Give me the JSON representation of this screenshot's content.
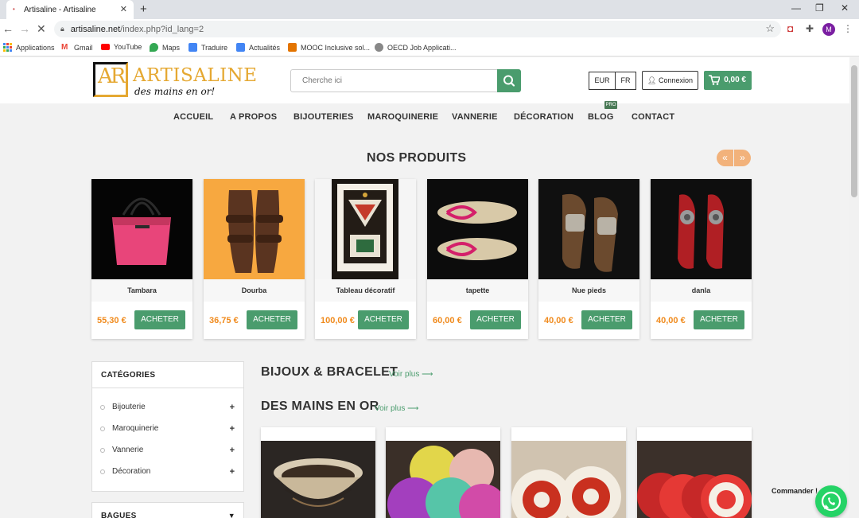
{
  "browser": {
    "tab_title": "Artisaline - Artisaline",
    "url_domain": "artisaline.net",
    "url_path": "/index.php?id_lang=2",
    "profile_initial": "M",
    "bookmarks": [
      {
        "label": "Applications",
        "color": "#4285f4"
      },
      {
        "label": "Gmail",
        "color": "#ea4335"
      },
      {
        "label": "YouTube",
        "color": "#ff0000"
      },
      {
        "label": "Maps",
        "color": "#34a853"
      },
      {
        "label": "Traduire",
        "color": "#4285f4"
      },
      {
        "label": "Actualités",
        "color": "#4285f4"
      },
      {
        "label": "MOOC Inclusive sol...",
        "color": "#e37400"
      },
      {
        "label": "OECD Job Applicati...",
        "color": "#666666"
      }
    ]
  },
  "header": {
    "logo_letters": "AR",
    "logo_name": "ARTISALINE",
    "logo_tagline": "des mains en or!",
    "search_placeholder": "Cherche ici",
    "currency_eur": "EUR",
    "lang_fr": "FR",
    "login_label": "Connexion",
    "cart_total": "0,00 €"
  },
  "nav": {
    "items": [
      "ACCUEIL",
      "A PROPOS",
      "BIJOUTERIES",
      "MAROQUINERIE",
      "VANNERIE",
      "DÉCORATION",
      "BLOG",
      "CONTACT"
    ],
    "blog_badge": "PRO"
  },
  "products_section": {
    "title": "NOS PRODUITS",
    "prev_icon": "«",
    "next_icon": "»",
    "buy_label": "ACHETER",
    "items": [
      {
        "name": "Tambara",
        "price": "55,30 €"
      },
      {
        "name": "Dourba",
        "price": "36,75 €"
      },
      {
        "name": "Tableau décoratif",
        "price": "100,00 €"
      },
      {
        "name": "tapette",
        "price": "60,00 €"
      },
      {
        "name": "Nue pieds",
        "price": "40,00 €"
      },
      {
        "name": "danla",
        "price": "40,00 €"
      }
    ]
  },
  "sidebar": {
    "categories_title": "CATÉGORIES",
    "categories": [
      "Bijouterie",
      "Maroquinerie",
      "Vannerie",
      "Décoration"
    ],
    "bagues_title": "BAGUES"
  },
  "sections": {
    "bijoux_title": "BIJOUX & BRACELET",
    "mains_title": "DES MAINS EN OR",
    "voir_plus": "Voir plus"
  },
  "whatsapp": {
    "label": "Commander !"
  },
  "colors": {
    "accent_green": "#4a9c6d",
    "price_orange": "#f08a1c",
    "logo_gold": "#e5a832"
  }
}
